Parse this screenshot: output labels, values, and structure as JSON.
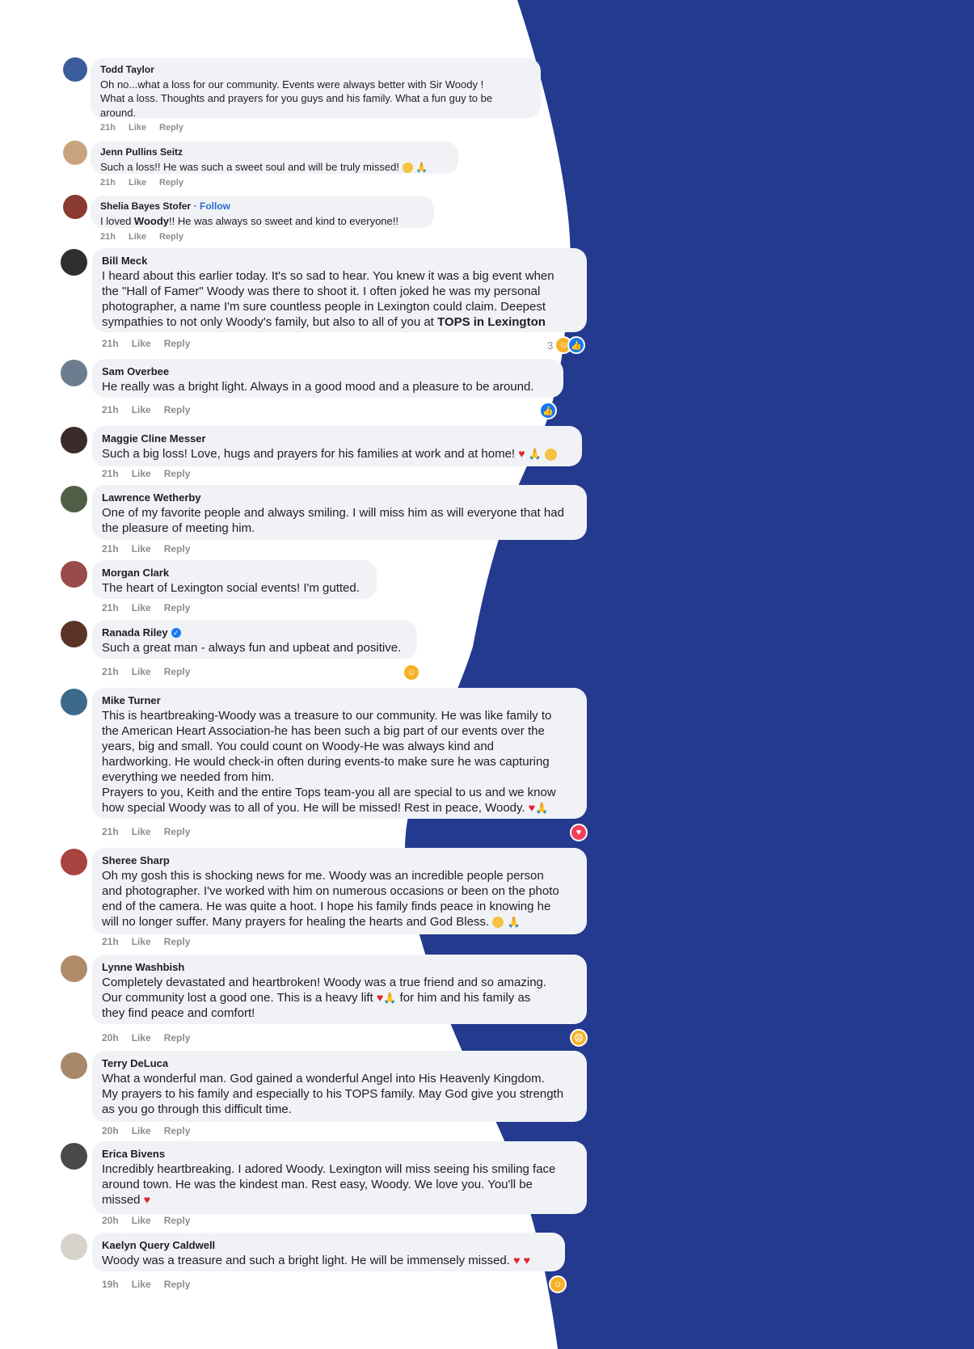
{
  "theme": {
    "accent_blue": "#233a8f",
    "bubble_gray": "#f0f2f5",
    "meta_gray": "#8a8d91",
    "link_blue": "#2c6ad6"
  },
  "action_like": "Like",
  "action_reply": "Reply",
  "comments": [
    {
      "author": "Todd Taylor",
      "text": "Oh no...what a loss for our community. Events were always better with Sir Woody !\nWhat a loss. Thoughts and prayers for you guys and his family. What a fun guy to be\naround.",
      "time": "21h",
      "avatar_color": "#3b5d9c"
    },
    {
      "author": "Jenn Pullins Seitz",
      "text": "Such a loss!! He was such a sweet soul and will be truly missed!",
      "emojis": [
        "sad-face-emoji",
        "praying-hands-emoji"
      ],
      "time": "21h",
      "avatar_color": "#c9a27e"
    },
    {
      "author": "Shelia Bayes Stofer",
      "follow": "· Follow",
      "text_prefix": "I loved ",
      "text_bold": "Woody",
      "text_suffix": "!! He was always so sweet and kind to everyone!!",
      "time": "21h",
      "avatar_color": "#8b3a2f"
    },
    {
      "author": "Bill Meck",
      "text_main": "I heard about this earlier today. It's so sad to hear. You knew it was a big event when\nthe \"Hall of Famer\" Woody was there to shoot it. I often joked he was my personal\nphotographer, a name I'm sure countless people in Lexington could claim. Deepest\nsympathies to not only Woody's family, but also to all of you at ",
      "text_bold": "TOPS in Lexington",
      "time": "21h",
      "reaction_count": "3",
      "reactions": [
        "care-emoji",
        "like-emoji"
      ],
      "avatar_color": "#2f2f2f"
    },
    {
      "author": "Sam Overbee",
      "text": "He really was a bright light. Always in a good mood and a pleasure to be around.",
      "time": "21h",
      "reactions": [
        "like-emoji"
      ],
      "avatar_color": "#6b7d8f"
    },
    {
      "author": "Maggie Cline Messer",
      "text": "Such a big loss! Love, hugs and prayers for his families at work and at home!",
      "emojis": [
        "red-heart-emoji",
        "praying-hands-emoji",
        "hugging-face-emoji"
      ],
      "time": "21h",
      "avatar_color": "#3a2a2a"
    },
    {
      "author": "Lawrence Wetherby",
      "text": "One of my favorite people and always smiling. I will miss him as will everyone that had\nthe pleasure of meeting him.",
      "time": "21h",
      "avatar_color": "#4f5f45"
    },
    {
      "author": "Morgan Clark",
      "text": "The heart of Lexington social events! I'm gutted.",
      "time": "21h",
      "avatar_color": "#9a4a4a"
    },
    {
      "author": "Ranada Riley",
      "verified": "✓",
      "text": "Such a great man - always fun and upbeat and positive.",
      "time": "21h",
      "reactions": [
        "care-emoji"
      ],
      "avatar_color": "#5a3324"
    },
    {
      "author": "Mike Turner",
      "text": "This is heartbreaking-Woody was a treasure to our community. He was like family to\nthe American Heart Association-he has been such a big part of our events over the\nyears, big and small. You could count on Woody-He was always kind and\nhardworking. He would check-in often during events-to make sure he was capturing\neverything we needed from him.\nPrayers to you, Keith and the entire Tops team-you all are special to us and we know\nhow special Woody was to all of you. He will be missed! Rest in peace, Woody.",
      "emojis": [
        "broken-heart-emoji",
        "praying-hands-emoji"
      ],
      "time": "21h",
      "reactions": [
        "love-emoji"
      ],
      "avatar_color": "#3d6a8a"
    },
    {
      "author": "Sheree Sharp",
      "text": "Oh my gosh this is shocking news for me. Woody was an incredible people person\nand photographer. I've worked with him on numerous occasions or been on the photo\nend of the camera. He was quite a hoot. I hope his family finds peace in knowing he\nwill no longer suffer. Many prayers for healing the hearts and God Bless.",
      "emojis": [
        "sad-face-emoji",
        "praying-hands-emoji"
      ],
      "time": "21h",
      "avatar_color": "#a8433f"
    },
    {
      "author": "Lynne Washbish",
      "text_a": "Completely devastated and heartbroken! Woody was a true friend and so amazing.\nOur community lost a good one. This is a heavy lift ",
      "text_b": " for him and his family as\nthey find peace and comfort!",
      "emojis": [
        "red-heart-emoji",
        "praying-hands-emoji"
      ],
      "time": "20h",
      "reactions": [
        "sad-emoji"
      ],
      "avatar_color": "#b08b6a"
    },
    {
      "author": "Terry DeLuca",
      "text": "What a wonderful man. God gained a wonderful Angel into His Heavenly Kingdom.\nMy prayers to his family and especially to his TOPS family. May God give you strength\nas you go through this difficult time.",
      "time": "20h",
      "avatar_color": "#a8876a"
    },
    {
      "author": "Erica Bivens",
      "text": "Incredibly heartbreaking. I adored Woody. Lexington will miss seeing his smiling face\naround town. He was the kindest man. Rest easy, Woody. We love you. You'll be\nmissed",
      "emojis": [
        "red-heart-emoji"
      ],
      "time": "20h",
      "avatar_color": "#4a4a4a"
    },
    {
      "author": "Kaelyn Query Caldwell",
      "text": "Woody was a treasure and such a bright light. He will be immensely missed.",
      "emojis": [
        "broken-heart-emoji",
        "heart-on-fire-emoji"
      ],
      "time": "19h",
      "reactions": [
        "care-emoji"
      ],
      "avatar_color": "#d8d2cc"
    }
  ]
}
